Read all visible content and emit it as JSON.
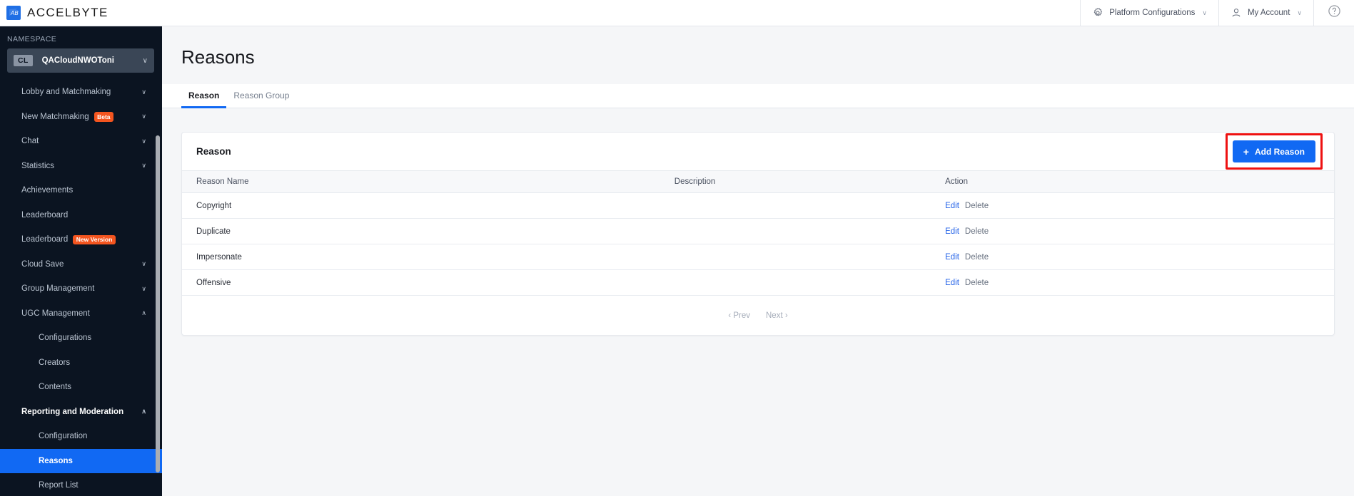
{
  "topbar": {
    "brand": "ACCELBYTE",
    "brand_icon": "accelbyte-logo-icon",
    "platform_configurations": "Platform Configurations",
    "platform_icon": "gear-icon",
    "my_account": "My Account",
    "account_icon": "user-icon",
    "help_icon": "question-circle-icon",
    "chevron": "∨"
  },
  "sidebar": {
    "namespace_label": "NAMESPACE",
    "namespace_badge": "CL",
    "namespace_value": "QACloudNWOToni",
    "namespace_chevron": "∨",
    "items": [
      {
        "label": "Lobby and Matchmaking",
        "level": 1,
        "chevron": "down",
        "active": false,
        "pill": ""
      },
      {
        "label": "New Matchmaking",
        "level": 1,
        "chevron": "down",
        "active": false,
        "pill": "Beta"
      },
      {
        "label": "Chat",
        "level": 1,
        "chevron": "down",
        "active": false,
        "pill": ""
      },
      {
        "label": "Statistics",
        "level": 1,
        "chevron": "down",
        "active": false,
        "pill": ""
      },
      {
        "label": "Achievements",
        "level": 1,
        "chevron": "none",
        "active": false,
        "pill": ""
      },
      {
        "label": "Leaderboard",
        "level": 1,
        "chevron": "none",
        "active": false,
        "pill": ""
      },
      {
        "label": "Leaderboard",
        "level": 1,
        "chevron": "none",
        "active": false,
        "pill": "New Version"
      },
      {
        "label": "Cloud Save",
        "level": 1,
        "chevron": "down",
        "active": false,
        "pill": ""
      },
      {
        "label": "Group Management",
        "level": 1,
        "chevron": "down",
        "active": false,
        "pill": ""
      },
      {
        "label": "UGC Management",
        "level": 1,
        "chevron": "up",
        "active": false,
        "pill": ""
      },
      {
        "label": "Configurations",
        "level": 2,
        "chevron": "none",
        "active": false,
        "pill": ""
      },
      {
        "label": "Creators",
        "level": 2,
        "chevron": "none",
        "active": false,
        "pill": ""
      },
      {
        "label": "Contents",
        "level": 2,
        "chevron": "none",
        "active": false,
        "pill": ""
      },
      {
        "label": "Reporting and Moderation",
        "level": 1,
        "chevron": "up",
        "active": false,
        "pill": "",
        "section_open": true
      },
      {
        "label": "Configuration",
        "level": 2,
        "chevron": "none",
        "active": false,
        "pill": ""
      },
      {
        "label": "Reasons",
        "level": 2,
        "chevron": "none",
        "active": true,
        "pill": ""
      },
      {
        "label": "Report List",
        "level": 2,
        "chevron": "none",
        "active": false,
        "pill": ""
      }
    ]
  },
  "main": {
    "page_title": "Reasons",
    "tabs": [
      {
        "label": "Reason",
        "active": true
      },
      {
        "label": "Reason Group",
        "active": false
      }
    ],
    "card": {
      "title": "Reason",
      "add_button": "Add Reason",
      "add_button_plus": "+",
      "highlighted": true,
      "columns": [
        "Reason Name",
        "Description",
        "Action"
      ],
      "rows": [
        {
          "name": "Copyright",
          "description": "",
          "edit": "Edit",
          "delete": "Delete"
        },
        {
          "name": "Duplicate",
          "description": "",
          "edit": "Edit",
          "delete": "Delete"
        },
        {
          "name": "Impersonate",
          "description": "",
          "edit": "Edit",
          "delete": "Delete"
        },
        {
          "name": "Offensive",
          "description": "",
          "edit": "Edit",
          "delete": "Delete"
        }
      ],
      "pagination": {
        "prev": "‹ Prev",
        "next": "Next ›"
      }
    }
  },
  "colors": {
    "accent": "#1169f3",
    "sidebar_bg": "#0b1421",
    "page_bg": "#f5f6f8",
    "pill": "#f4551f",
    "highlight_box": "#ee1111",
    "link": "#2563e8"
  }
}
